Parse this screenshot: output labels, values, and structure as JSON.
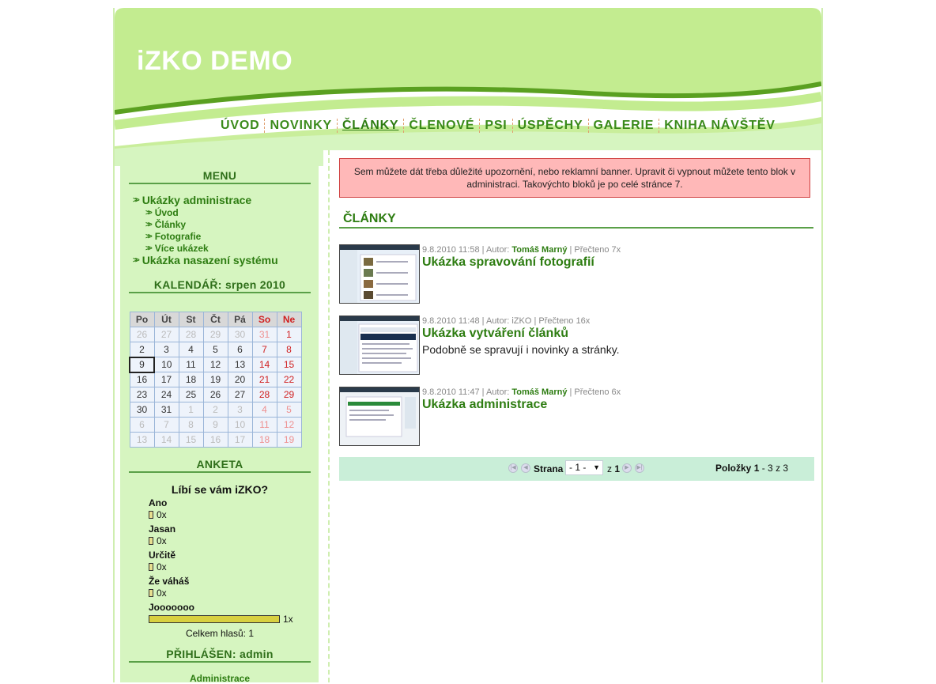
{
  "header": {
    "site_title": "iZKO DEMO"
  },
  "nav": {
    "items": [
      {
        "label": "ÚVOD"
      },
      {
        "label": "NOVINKY"
      },
      {
        "label": "ČLÁNKY"
      },
      {
        "label": "ČLENOVÉ"
      },
      {
        "label": "PSI"
      },
      {
        "label": "ÚSPĚCHY"
      },
      {
        "label": "GALERIE"
      },
      {
        "label": "KNIHA NÁVŠTĚV"
      }
    ],
    "active": "ČLÁNKY"
  },
  "sidebar": {
    "menu_heading": "MENU",
    "menu": {
      "group1": "Ukázky administrace",
      "sub": [
        "Úvod",
        "Články",
        "Fotografie",
        "Více ukázek"
      ],
      "group2": "Ukázka nasazení systému"
    },
    "calendar": {
      "heading": "KALENDÁŘ: srpen 2010",
      "weekdays": [
        "Po",
        "Út",
        "St",
        "Čt",
        "Pá",
        "So",
        "Ne"
      ],
      "weeks": [
        [
          "26",
          "27",
          "28",
          "29",
          "30",
          "31",
          "1"
        ],
        [
          "2",
          "3",
          "4",
          "5",
          "6",
          "7",
          "8"
        ],
        [
          "9",
          "10",
          "11",
          "12",
          "13",
          "14",
          "15"
        ],
        [
          "16",
          "17",
          "18",
          "19",
          "20",
          "21",
          "22"
        ],
        [
          "23",
          "24",
          "25",
          "26",
          "27",
          "28",
          "29"
        ],
        [
          "30",
          "31",
          "1",
          "2",
          "3",
          "4",
          "5"
        ],
        [
          "6",
          "7",
          "8",
          "9",
          "10",
          "11",
          "12"
        ],
        [
          "13",
          "14",
          "15",
          "16",
          "17",
          "18",
          "19"
        ]
      ],
      "today": "9"
    },
    "poll": {
      "heading": "ANKETA",
      "question": "Líbí se vám iZKO?",
      "options": [
        {
          "label": "Ano",
          "votes": "0x"
        },
        {
          "label": "Jasan",
          "votes": "0x"
        },
        {
          "label": "Určitě",
          "votes": "0x"
        },
        {
          "label": "Že váháš",
          "votes": "0x"
        },
        {
          "label": "Jooooooo",
          "votes": "1x"
        }
      ],
      "total": "Celkem hlasů: 1"
    },
    "login": {
      "heading": "PŘIHLÁŠEN: admin",
      "link": "Administrace"
    }
  },
  "content": {
    "notice": "Sem můžete dát třeba důležité upozornění, nebo reklamní banner. Upravit či vypnout můžete tento blok v administraci. Takovýchto bloků je po celé stránce 7.",
    "title": "ČLÁNKY",
    "articles": [
      {
        "date": "9.8.2010 11:58 | Autor: ",
        "author": "Tomáš Marný",
        "reads": " | Přečteno 7x",
        "title": "Ukázka spravování fotografií",
        "desc": ""
      },
      {
        "date": "9.8.2010 11:48 | Autor: ",
        "author": "iZKO",
        "reads": " | Přečteno 16x",
        "title": "Ukázka vytváření článků",
        "desc": "Podobně se spravují i novinky a stránky."
      },
      {
        "date": "9.8.2010 11:47 | Autor: ",
        "author": "Tomáš Marný",
        "reads": " | Přečteno 6x",
        "title": "Ukázka administrace",
        "desc": ""
      }
    ],
    "pager": {
      "page_label": "Strana",
      "page_value": "- 1 -",
      "of_label": "z",
      "of_total": "1",
      "items_label": "Položky",
      "items_from": "1",
      "items_range": " - 3 z 3"
    }
  },
  "colors": {
    "brand_green": "#2e7d12",
    "header_green": "#c3ec90",
    "sidebar_bg": "#d6f5c0",
    "notice_bg": "#ffb8b8",
    "pager_bg": "#c9eed8"
  }
}
